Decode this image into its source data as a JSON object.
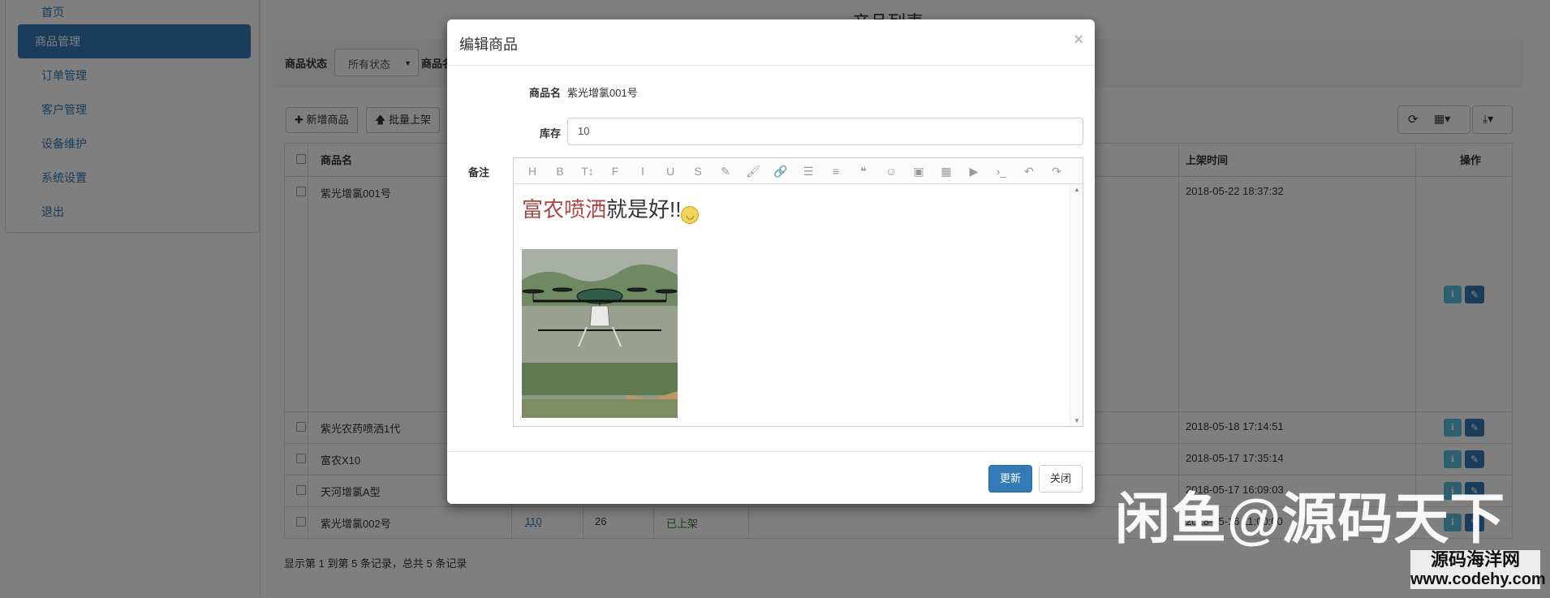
{
  "sidebar": {
    "items": [
      {
        "label": "首页"
      },
      {
        "label": "商品管理"
      },
      {
        "label": "订单管理"
      },
      {
        "label": "客户管理"
      },
      {
        "label": "设备维护"
      },
      {
        "label": "系统设置"
      },
      {
        "label": "退出"
      }
    ]
  },
  "page": {
    "title": "产品列表",
    "filter": {
      "status_label": "商品状态",
      "status_value": "所有状态",
      "name_label": "商品名"
    },
    "toolbar": {
      "add_label": "新增商品",
      "batch_label": "批量上架"
    },
    "table": {
      "headers": {
        "name": "商品名",
        "time": "上架时间",
        "actions": "操作"
      },
      "rows": [
        {
          "name": "紫光增氯001号",
          "time": "2018-05-22 18:37:32"
        },
        {
          "name": "紫光农药喷洒1代",
          "time": "2018-05-18 17:14:51"
        },
        {
          "name": "富农X10",
          "time": "2018-05-17 17:35:14"
        },
        {
          "name": "天河增氯A型",
          "time": "2018-05-17 16:09:03"
        },
        {
          "name": "紫光增氯002号",
          "stock_link": "110",
          "qty": "26",
          "status": "已上架",
          "time": "2018-05-16 11:00:00"
        }
      ]
    },
    "footer": "显示第 1 到第 5 条记录，总共 5 条记录"
  },
  "modal": {
    "title": "编辑商品",
    "close": "×",
    "fields": {
      "name_label": "商品名",
      "name_value": "紫光增氯001号",
      "stock_label": "库存",
      "stock_value": "10",
      "note_label": "备注"
    },
    "editor": {
      "toolbar_icons": [
        "heading-icon",
        "bold-icon",
        "text-size-icon",
        "font-icon",
        "italic-icon",
        "underline-icon",
        "strikethrough-icon",
        "highlight-icon",
        "brush-icon",
        "link-icon",
        "bullet-list-icon",
        "align-icon",
        "quote-icon",
        "emoji-icon",
        "image-icon",
        "table-icon",
        "video-icon",
        "code-icon",
        "undo-icon",
        "redo-icon"
      ],
      "toolbar_glyphs": [
        "H",
        "B",
        "T↕",
        "F",
        "I",
        "U",
        "S",
        "✎",
        "🖌",
        "🔗",
        "☰",
        "≡",
        "❝",
        "☺",
        "▣",
        "▦",
        "▶",
        "›_",
        "↶",
        "↷"
      ],
      "content_red": "富农喷洒",
      "content_black": "就是好!!"
    },
    "buttons": {
      "update": "更新",
      "close": "关闭"
    }
  },
  "watermark": {
    "main": "闲鱼@源码天下",
    "site_name": "源码海洋网",
    "site_url": "www.codehy.com"
  }
}
